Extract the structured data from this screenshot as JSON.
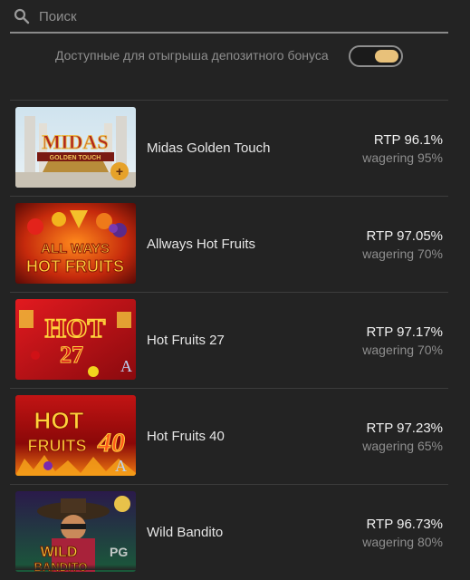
{
  "search": {
    "placeholder": "Поиск",
    "icon": "search-icon"
  },
  "filter": {
    "label": "Доступные для отыгрыша депозитного бонуса",
    "toggle_on": true,
    "toggle_color": "#e8c17a"
  },
  "games": [
    {
      "name": "Midas Golden Touch",
      "rtp": "RTP 96.1%",
      "wagering": "wagering 95%",
      "thumb_text": [
        "MIDAS",
        "GOLDEN TOUCH"
      ]
    },
    {
      "name": "Allways Hot Fruits",
      "rtp": "RTP 97.05%",
      "wagering": "wagering 70%",
      "thumb_text": [
        "ALL WAYS",
        "HOT FRUITS"
      ]
    },
    {
      "name": "Hot Fruits 27",
      "rtp": "RTP 97.17%",
      "wagering": "wagering 70%",
      "thumb_text": [
        "HOT",
        "27"
      ]
    },
    {
      "name": "Hot Fruits 40",
      "rtp": "RTP 97.23%",
      "wagering": "wagering 65%",
      "thumb_text": [
        "HOT",
        "FRUITS",
        "40"
      ]
    },
    {
      "name": "Wild Bandito",
      "rtp": "RTP 96.73%",
      "wagering": "wagering 80%",
      "thumb_text": [
        "WILD",
        "BANDITO",
        "PG"
      ]
    }
  ]
}
